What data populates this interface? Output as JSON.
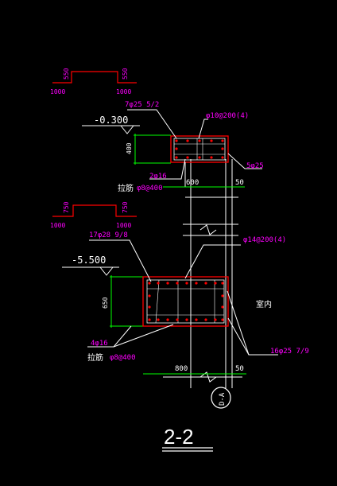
{
  "colors": {
    "background": "#000000",
    "white_line": "#ffffff",
    "green_line": "#00ff00",
    "red_line": "#ff0000",
    "magenta_text": "#ff00ff"
  },
  "upper_profile": {
    "left_h": "550",
    "right_h": "550",
    "left_w": "1000",
    "right_w": "1000"
  },
  "lower_profile": {
    "left_h": "750",
    "right_h": "750",
    "left_w": "1000",
    "right_w": "1000"
  },
  "upper_beam": {
    "elevation": "-0.300",
    "top_rebar": "7φ25  5/2",
    "stirrup": "φ10@200(4)",
    "height": "400",
    "side_rebar": "2φ16",
    "tie_label": "拉筋",
    "tie_spec": "φ8@400",
    "width": "600",
    "offset": "50",
    "bottom_rebar": "5φ25"
  },
  "lower_beam": {
    "elevation": "-5.500",
    "top_rebar": "17φ28  9/8",
    "stirrup": "φ14@200(4)",
    "height": "650",
    "side_rebar": "4φ16",
    "tie_label": "拉筋",
    "tie_spec": "φ8@400",
    "width": "800",
    "offset": "50",
    "bottom_rebar": "16φ25  7/9",
    "room_label": "室内"
  },
  "axis_label": "D-A",
  "section_title": "2-2"
}
